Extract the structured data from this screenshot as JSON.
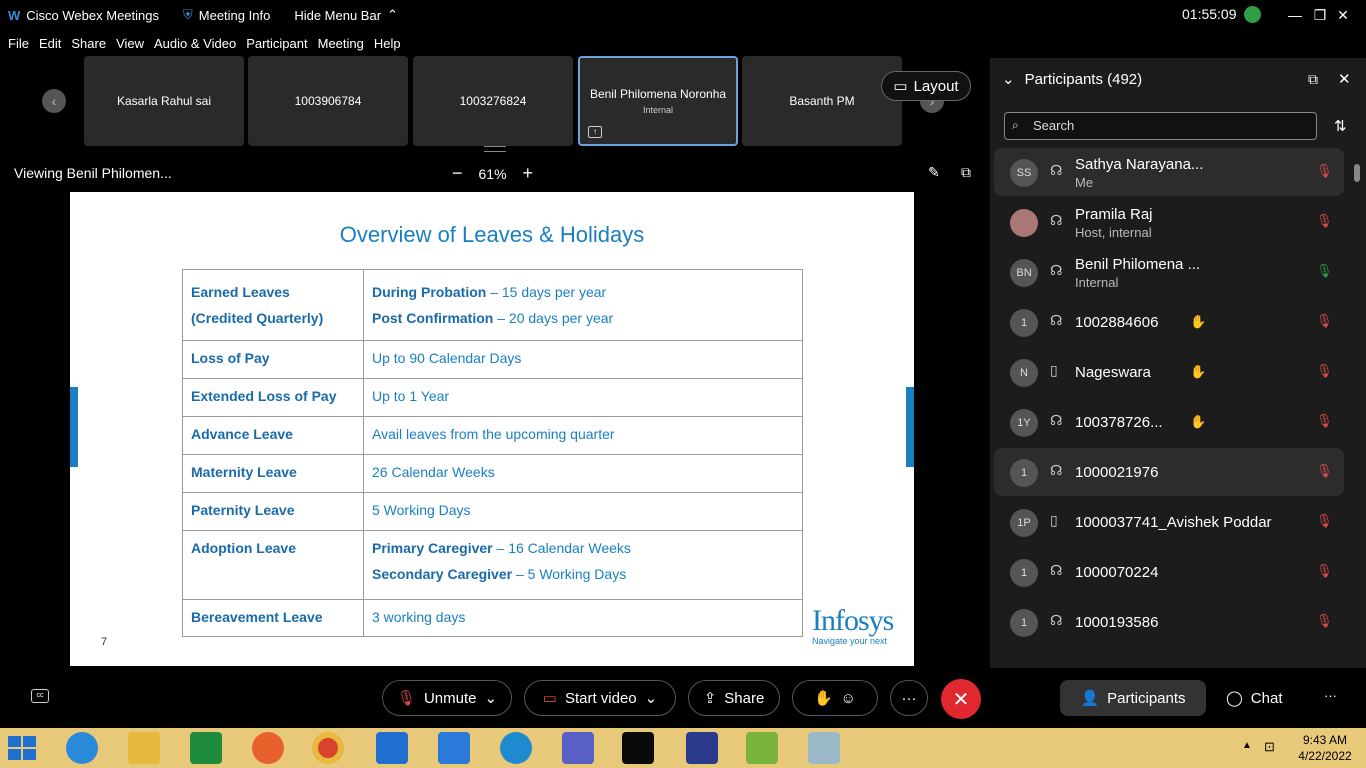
{
  "titlebar": {
    "app_name": "Cisco Webex Meetings",
    "meeting_info": "Meeting Info",
    "hide_menu": "Hide Menu Bar",
    "timer": "01:55:09",
    "minimize": "—",
    "maximize": "❐",
    "close": "✕"
  },
  "menubar": [
    "File",
    "Edit",
    "Share",
    "View",
    "Audio & Video",
    "Participant",
    "Meeting",
    "Help"
  ],
  "thumbnails": [
    {
      "name": "Kasarla Rahul sai",
      "sub": ""
    },
    {
      "name": "1003906784",
      "sub": ""
    },
    {
      "name": "1003276824",
      "sub": ""
    },
    {
      "name": "Benil Philomena Noronha",
      "sub": "Internal"
    },
    {
      "name": "Basanth PM",
      "sub": ""
    }
  ],
  "layout_label": "Layout",
  "viewing_label": "Viewing Benil Philomen...",
  "zoom": {
    "minus": "−",
    "value": "61%",
    "plus": "+"
  },
  "slide": {
    "title": "Overview of Leaves & Holidays",
    "page_number": "7",
    "logo_brand": "Infosys",
    "logo_tagline": "Navigate your next",
    "rows": [
      {
        "left": [
          "Earned Leaves",
          "(Credited Quarterly)"
        ],
        "right": [
          {
            "bold": "During Probation",
            "rest": " – 15 days per year"
          },
          {
            "bold": "Post Confirmation",
            "rest": " – 20 days per year"
          }
        ]
      },
      {
        "left": [
          "Loss of Pay"
        ],
        "right": [
          {
            "bold": "",
            "rest": "Up to 90 Calendar Days"
          }
        ]
      },
      {
        "left": [
          "Extended Loss of Pay"
        ],
        "right": [
          {
            "bold": "",
            "rest": "Up to 1 Year"
          }
        ]
      },
      {
        "left": [
          "Advance Leave"
        ],
        "right": [
          {
            "bold": "",
            "rest": "Avail leaves from the upcoming quarter"
          }
        ]
      },
      {
        "left": [
          "Maternity Leave"
        ],
        "right": [
          {
            "bold": "",
            "rest": "26 Calendar Weeks"
          }
        ]
      },
      {
        "left": [
          "Paternity Leave"
        ],
        "right": [
          {
            "bold": "",
            "rest": "5 Working Days"
          }
        ]
      },
      {
        "left": [
          "Adoption Leave"
        ],
        "right": [
          {
            "bold": "Primary Caregiver",
            "rest": " – 16 Calendar Weeks"
          },
          {
            "bold": "Secondary Caregiver",
            "rest": " – 5 Working Days"
          }
        ]
      },
      {
        "left": [
          "Bereavement Leave"
        ],
        "right": [
          {
            "bold": "",
            "rest": "3 working days"
          }
        ]
      }
    ]
  },
  "panel": {
    "title": "Participants (492)",
    "search_placeholder": "Search",
    "participants": [
      {
        "initials": "SS",
        "name": "Sathya Narayana...",
        "sub": "Me",
        "hand": false,
        "mic_on": false,
        "highlight": true,
        "device": "headset"
      },
      {
        "initials": "",
        "name": "Pramila Raj",
        "sub": "Host, internal",
        "hand": false,
        "mic_on": false,
        "highlight": false,
        "device": "headset"
      },
      {
        "initials": "BN",
        "name": "Benil Philomena ...",
        "sub": "Internal",
        "hand": false,
        "mic_on": true,
        "highlight": false,
        "device": "headset"
      },
      {
        "initials": "1",
        "name": "1002884606",
        "sub": "",
        "hand": true,
        "mic_on": false,
        "highlight": false,
        "device": "headset"
      },
      {
        "initials": "N",
        "name": "Nageswara",
        "sub": "",
        "hand": true,
        "mic_on": false,
        "highlight": false,
        "device": "phone"
      },
      {
        "initials": "1Y",
        "name": "100378726...",
        "sub": "",
        "hand": true,
        "mic_on": false,
        "highlight": false,
        "device": "headset"
      },
      {
        "initials": "1",
        "name": "1000021976",
        "sub": "",
        "hand": false,
        "mic_on": false,
        "highlight": true,
        "device": "headset"
      },
      {
        "initials": "1P",
        "name": "1000037741_Avishek Poddar",
        "sub": "",
        "hand": false,
        "mic_on": false,
        "highlight": false,
        "device": "phone"
      },
      {
        "initials": "1",
        "name": "1000070224",
        "sub": "",
        "hand": false,
        "mic_on": false,
        "highlight": false,
        "device": "headset"
      },
      {
        "initials": "1",
        "name": "1000193586",
        "sub": "",
        "hand": false,
        "mic_on": false,
        "highlight": false,
        "device": "headset"
      }
    ]
  },
  "controls": {
    "unmute": "Unmute",
    "start_video": "Start video",
    "share": "Share",
    "participants": "Participants",
    "chat": "Chat",
    "more": "···"
  },
  "taskbar": {
    "time": "9:43 AM",
    "date": "4/22/2022"
  },
  "colors": {
    "accent": "#1a7fc1",
    "leave_red": "#e0282e",
    "mic_muted": "#e04b4b",
    "mic_on": "#2f9e44",
    "taskbar": "#e8c97a"
  }
}
